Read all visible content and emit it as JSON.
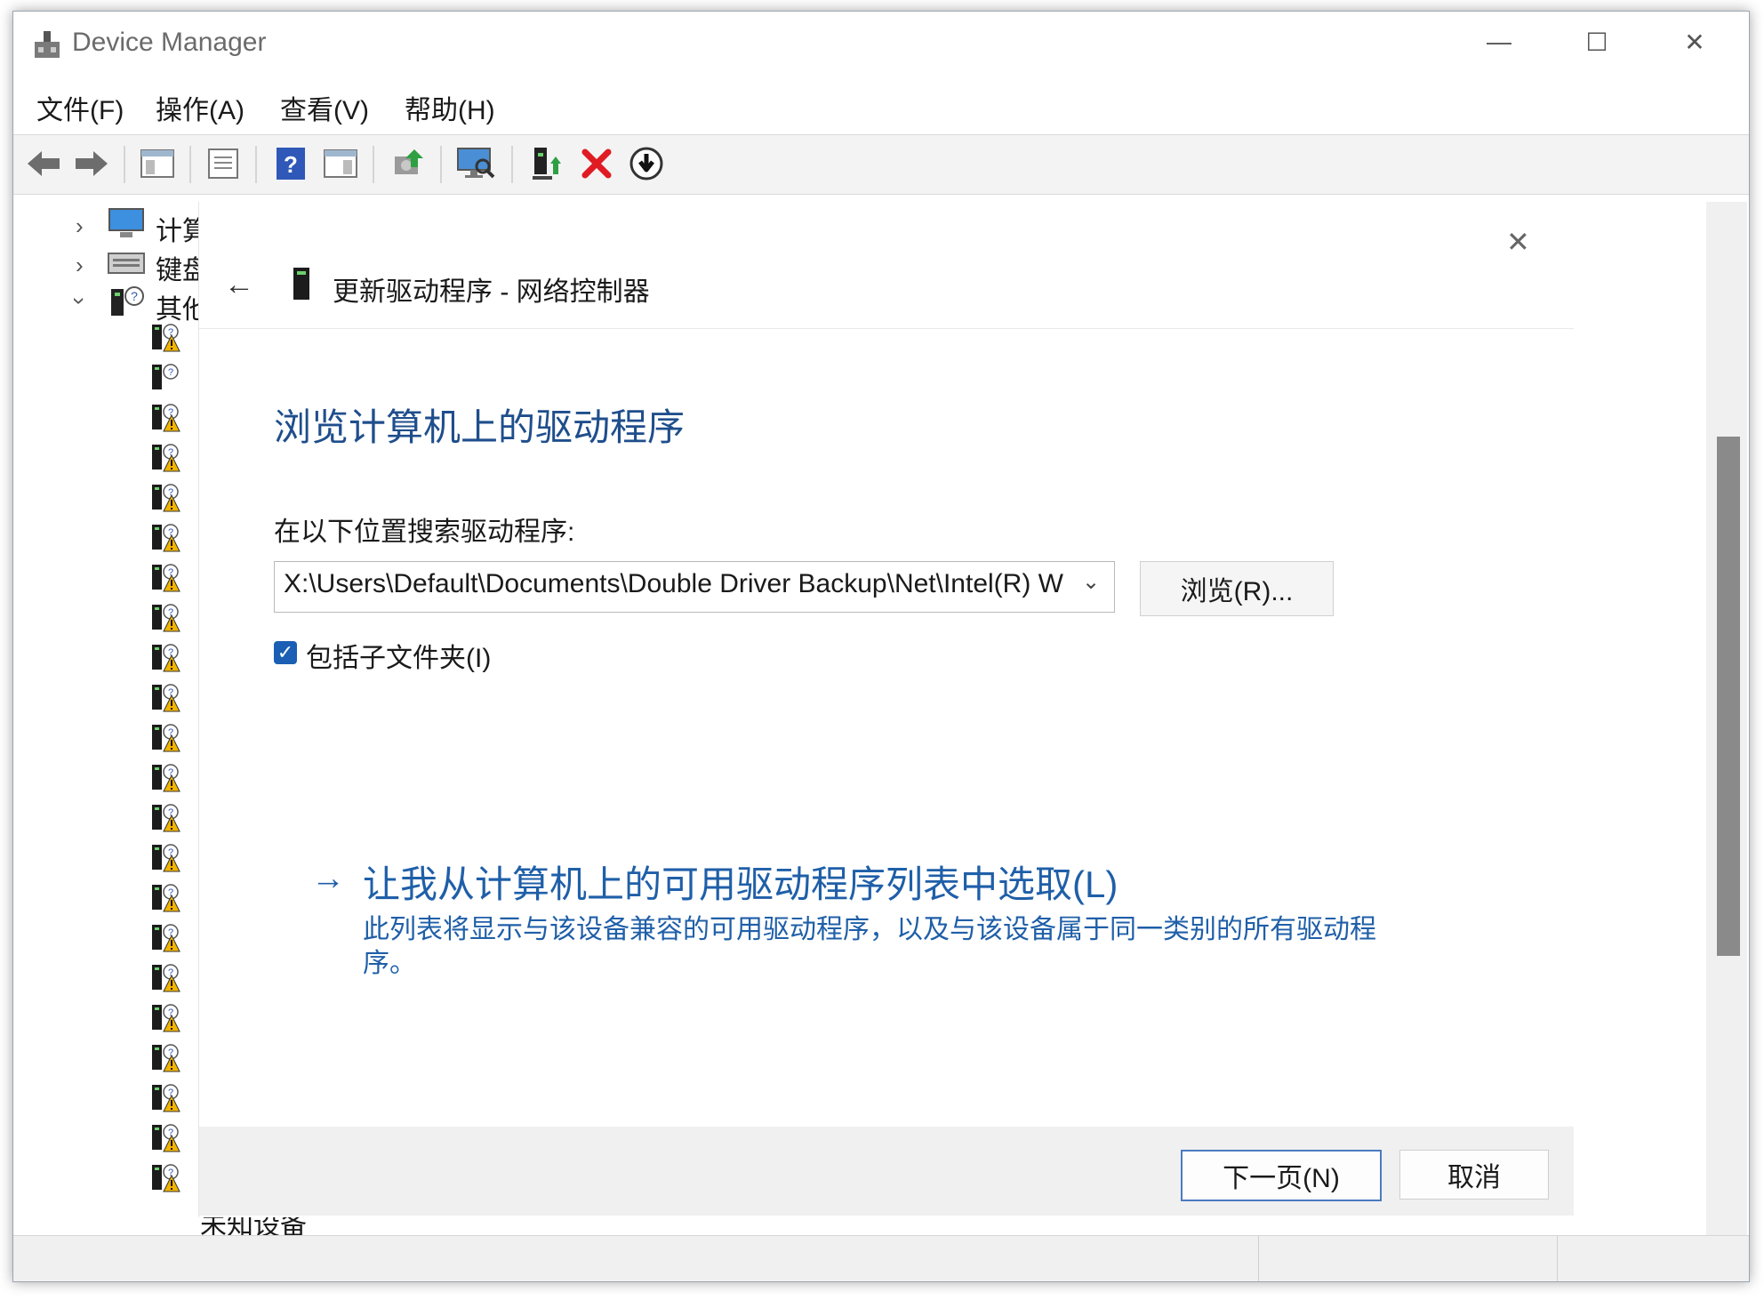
{
  "window": {
    "title": "Device Manager",
    "caption": {
      "minimize": "—",
      "maximize": "☐",
      "close": "✕"
    }
  },
  "menu": [
    "文件(F)",
    "操作(A)",
    "查看(V)",
    "帮助(H)"
  ],
  "toolbar": {
    "icons": [
      "back-icon",
      "forward-icon",
      "show-hide-tree-icon",
      "properties-icon",
      "help-icon",
      "action-pane-icon",
      "update-driver-icon",
      "scan-hardware-icon",
      "enable-device-icon",
      "uninstall-icon",
      "download-driver-icon"
    ]
  },
  "tree": {
    "categories": [
      {
        "label": "计算",
        "icon": "computer-icon",
        "expanded": false
      },
      {
        "label": "键盘",
        "icon": "keyboard-icon",
        "expanded": false
      },
      {
        "label": "其他",
        "icon": "other-devices-icon",
        "expanded": true
      }
    ],
    "last_item_label": "未知设备"
  },
  "dialog": {
    "back": "←",
    "title": "更新驱动程序 - 网络控制器",
    "close": "✕",
    "heading": "浏览计算机上的驱动程序",
    "search_label": "在以下位置搜索驱动程序:",
    "path_value": "X:\\Users\\Default\\Documents\\Double Driver Backup\\Net\\Intel(R) W",
    "browse_label": "浏览(R)...",
    "include_subfolders_label": "包括子文件夹(I)",
    "include_subfolders_checked": true,
    "pick_arrow": "→",
    "pick_title": "让我从计算机上的可用驱动程序列表中选取(L)",
    "pick_desc": "此列表将显示与该设备兼容的可用驱动程序，以及与该设备属于同一类别的所有驱动程序。",
    "next_label": "下一页(N)",
    "cancel_label": "取消"
  },
  "colors": {
    "accent": "#1f5fa8",
    "heading": "#1f4e8c",
    "warning": "#f2b400"
  }
}
